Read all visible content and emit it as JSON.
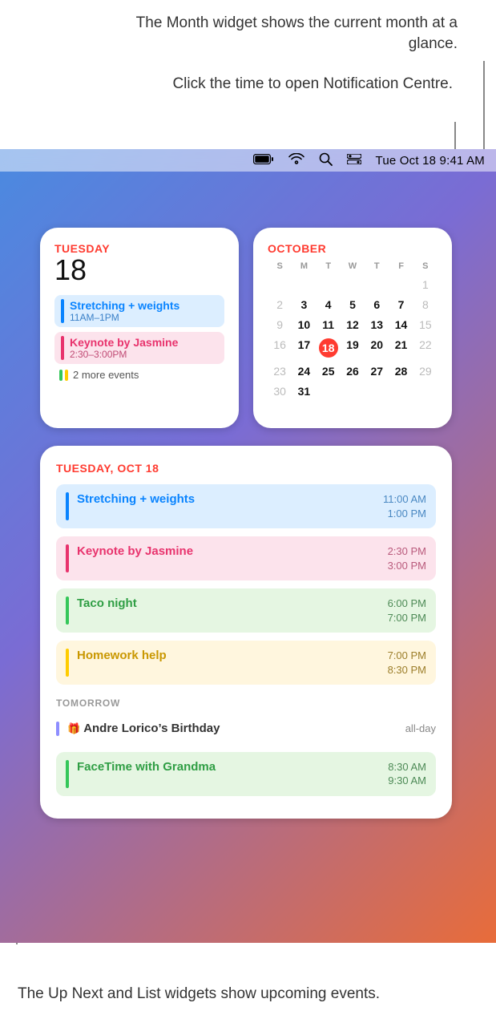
{
  "callouts": {
    "month": "The Month widget shows the current month at a glance.",
    "time": "Click the time to open Notification Centre.",
    "upnext": "The Up Next and List widgets show upcoming events."
  },
  "menubar": {
    "clock": "Tue Oct 18  9:41 AM"
  },
  "upnext": {
    "day_label": "Tuesday",
    "day_number": "18",
    "events": [
      {
        "title": "Stretching + weights",
        "time": "11AM–1PM",
        "color": "blue"
      },
      {
        "title": "Keynote by Jasmine",
        "time": "2:30–3:00PM",
        "color": "pink"
      }
    ],
    "more_label": "2 more events",
    "more_colors": [
      "#34C759",
      "#FFCC00"
    ]
  },
  "month": {
    "title": "October",
    "dow": [
      "S",
      "M",
      "T",
      "W",
      "T",
      "F",
      "S"
    ],
    "lead_blanks": 6,
    "days": 31,
    "prev_trail_start": 1,
    "today": 18,
    "weekend_cols": [
      0,
      6
    ]
  },
  "list": {
    "header": "Tuesday, Oct 18",
    "events": [
      {
        "title": "Stretching + weights",
        "start": "11:00 AM",
        "end": "1:00 PM",
        "color": "blue"
      },
      {
        "title": "Keynote by Jasmine",
        "start": "2:30 PM",
        "end": "3:00 PM",
        "color": "pink"
      },
      {
        "title": "Taco night",
        "start": "6:00 PM",
        "end": "7:00 PM",
        "color": "green"
      },
      {
        "title": "Homework help",
        "start": "7:00 PM",
        "end": "8:30 PM",
        "color": "yellow"
      }
    ],
    "sub_header": "Tomorrow",
    "tomorrow": [
      {
        "title": "Andre Lorico’s Birthday",
        "allday": "all-day",
        "color": "birthday"
      },
      {
        "title": "FaceTime with Grandma",
        "start": "8:30 AM",
        "end": "9:30 AM",
        "color": "green"
      }
    ]
  }
}
